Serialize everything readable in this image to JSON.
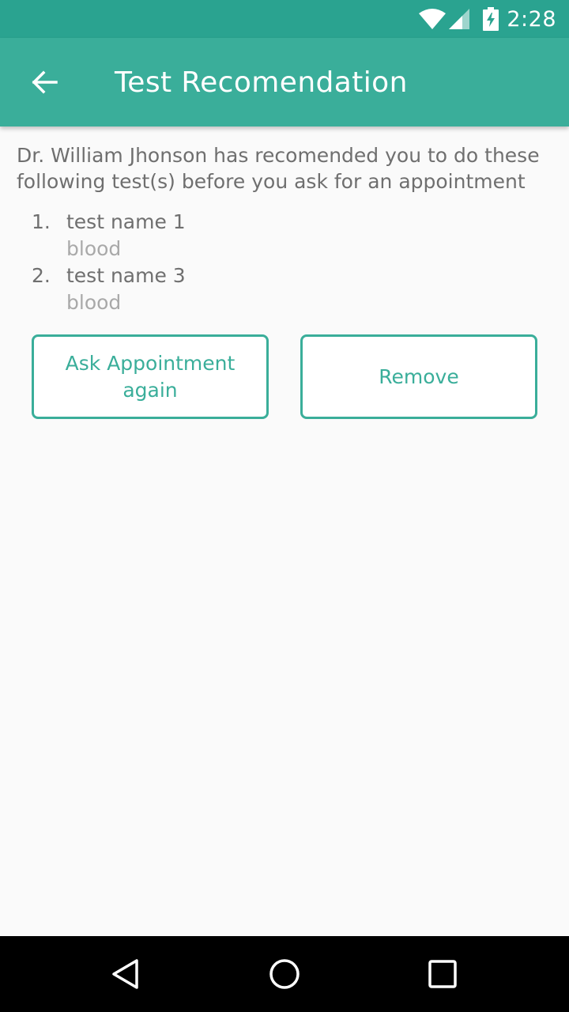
{
  "status_bar": {
    "time": "2:28",
    "icons": [
      "wifi-icon",
      "signal-icon",
      "battery-charging-icon"
    ]
  },
  "app_bar": {
    "back_icon": "arrow-left-icon",
    "title": "Test Recomendation"
  },
  "intro_text": "Dr. William Jhonson has recomended you to do these following test(s) before you ask for an appointment",
  "tests": [
    {
      "number": "1.",
      "name": "test name 1",
      "type": "blood"
    },
    {
      "number": "2.",
      "name": "test name 3",
      "type": "blood"
    }
  ],
  "buttons": {
    "ask_appointment": "Ask Appointment again",
    "remove": "Remove"
  },
  "nav_bar": {
    "icons": [
      "triangle-back-icon",
      "circle-home-icon",
      "square-recents-icon"
    ]
  },
  "colors": {
    "status_bar": "#2aa390",
    "app_bar": "#3aae9a",
    "accent": "#3aae9a",
    "background": "#fafafa",
    "body_text": "#6f6f6f",
    "secondary_text": "#a9a9a9"
  }
}
